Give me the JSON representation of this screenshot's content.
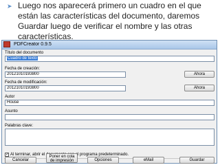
{
  "slide": {
    "bullet_text": "Luego nos aparecerá primero un cuadro en el que están las características del documento, daremos Guardar luego de verificar el nombre y las otras características."
  },
  "dialog": {
    "title": "PDFCreator 0.9.5",
    "title_label": "Título del documento",
    "title_value": "Cuadro de texto",
    "creation_label": "Fecha de creación:",
    "creation_value": "20121010193800",
    "modification_label": "Fecha de modificación:",
    "modification_value": "20121010193800",
    "now_label": "Ahora",
    "author_label": "Autor",
    "author_value": "House",
    "subject_label": "Asunto",
    "subject_value": "",
    "keywords_label": "Palabras clave:",
    "keywords_value": "",
    "checkbox_label": "Al terminar, abrir el documento con el programa predeterminado.",
    "checkbox_checked": true,
    "buttons": {
      "cancel": "Cancelar",
      "queue": "Poner en cola de impresión",
      "options": "Opciones",
      "email": "eMail",
      "save": "Guardar"
    }
  },
  "colors": {
    "accent": "#5b8ec8",
    "titlebar": "#a9c6e8",
    "selection": "#3a7ed8"
  }
}
